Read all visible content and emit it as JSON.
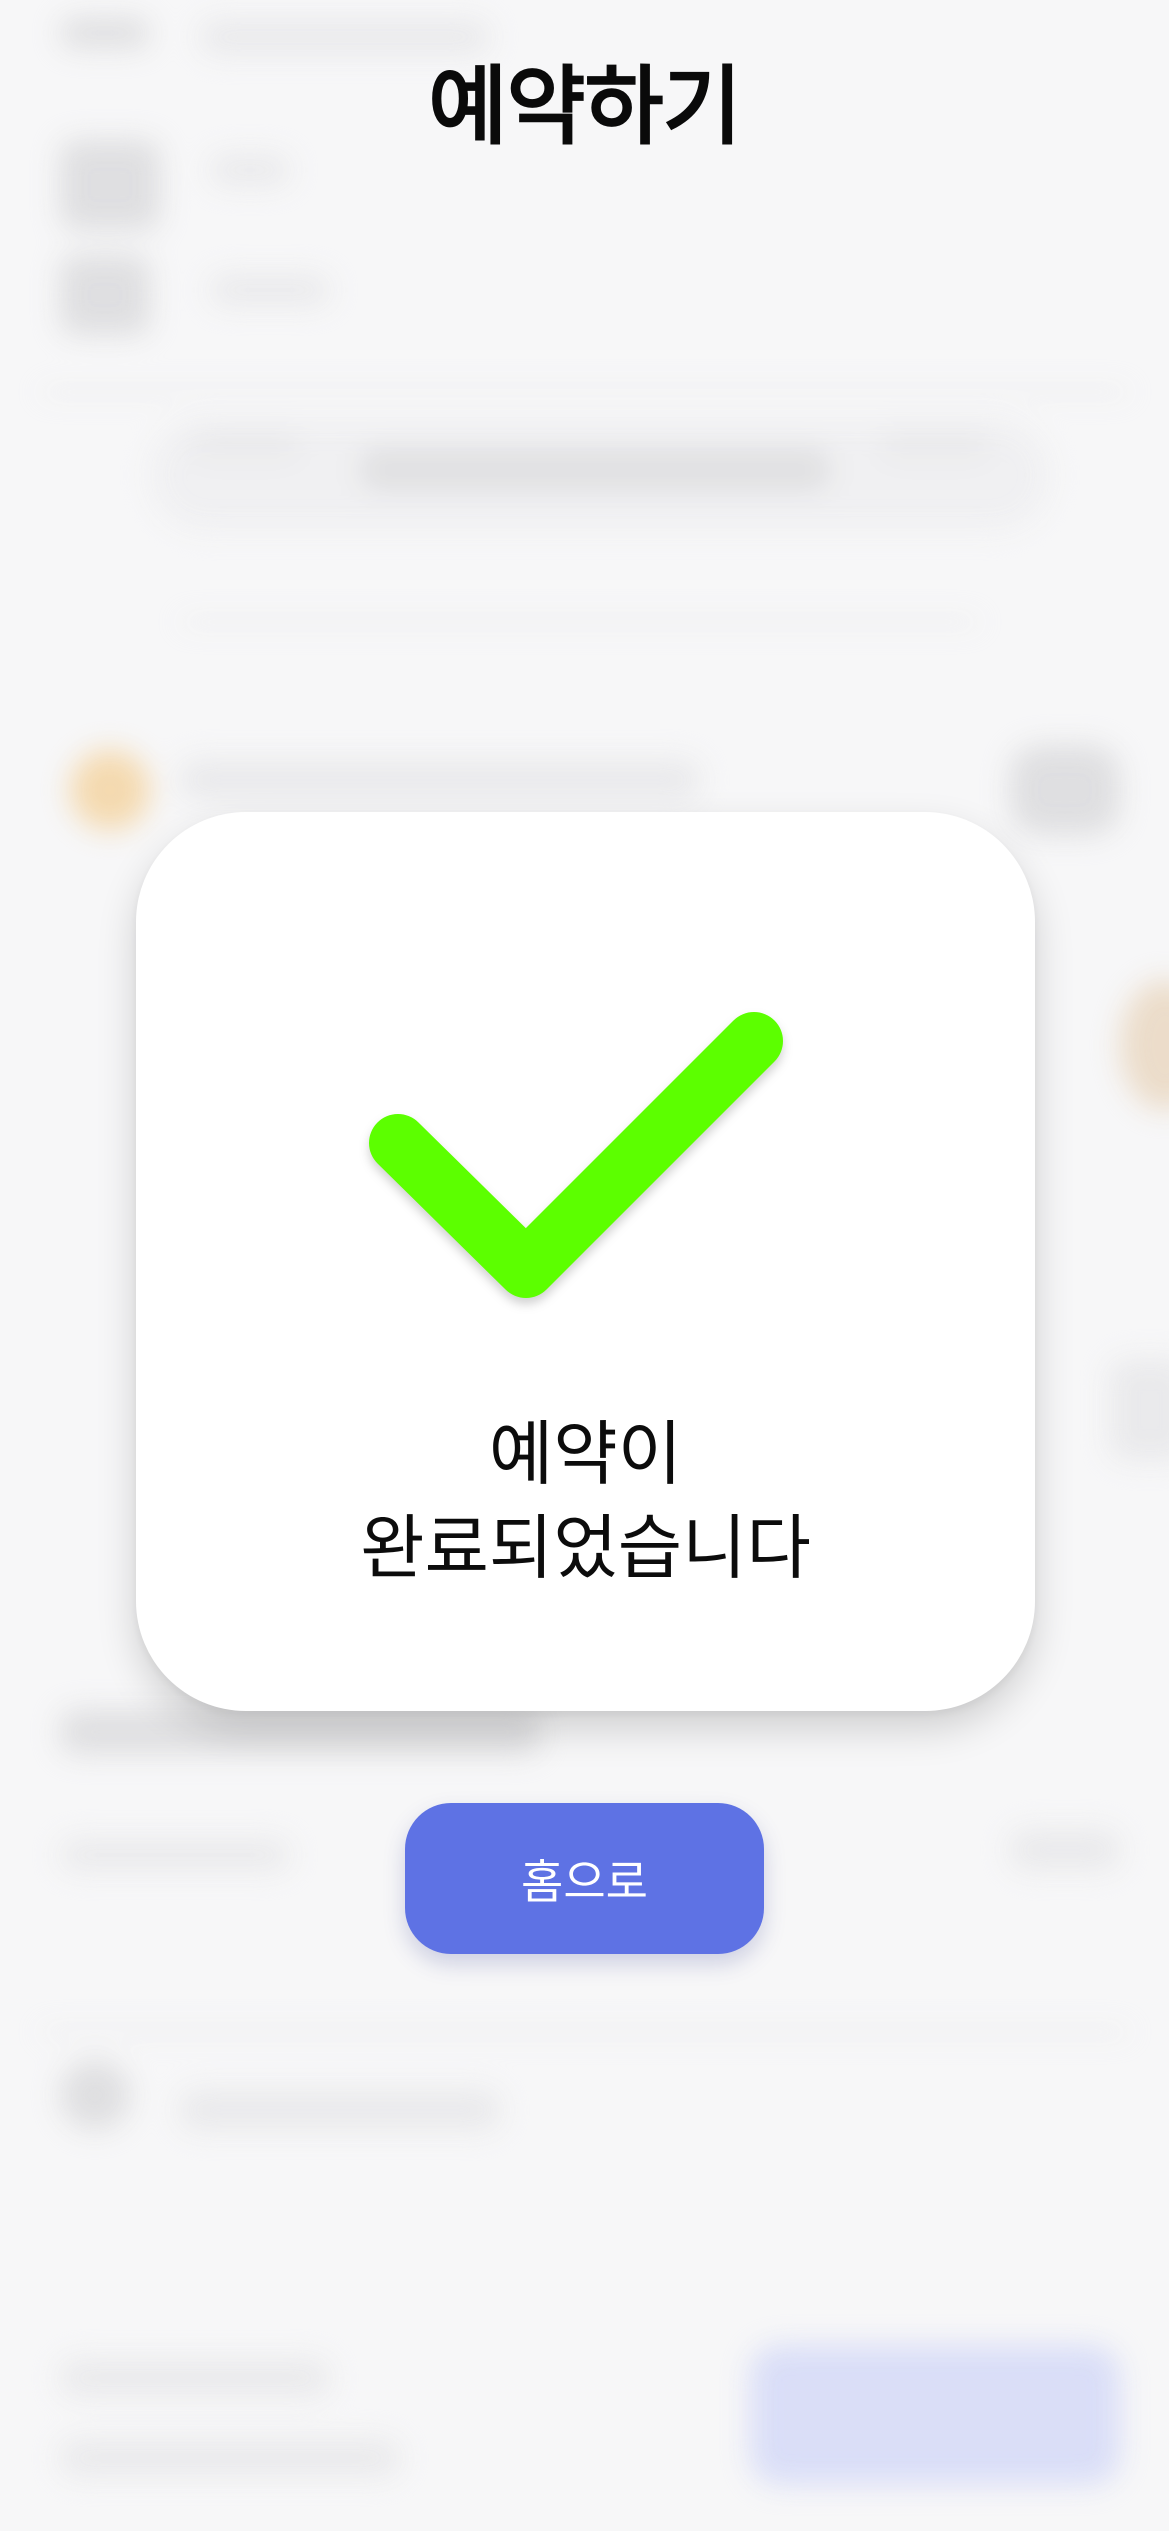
{
  "header": {
    "title": "예약하기"
  },
  "modal": {
    "icon": "check-icon",
    "icon_color": "#5cff00",
    "message_line1": "예약이",
    "message_line2": "완료되었습니다"
  },
  "actions": {
    "home_button_label": "홈으로",
    "home_button_color": "#5e72e4"
  }
}
